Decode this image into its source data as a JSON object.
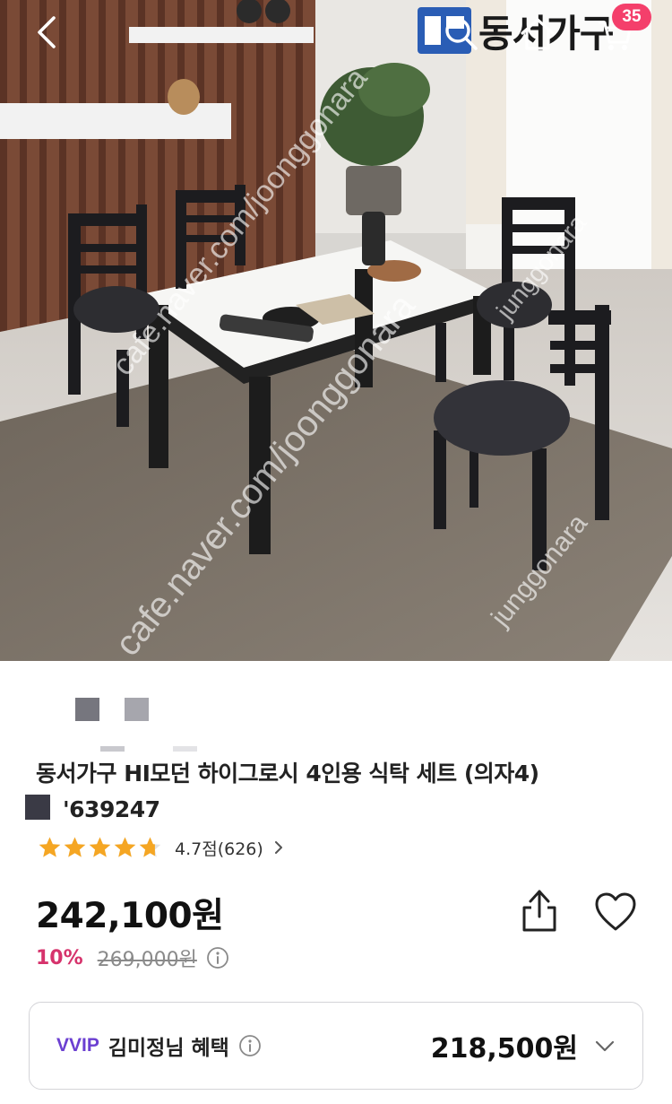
{
  "header": {
    "brand_name": "동서가구",
    "cart_count": "35",
    "icons": [
      "back-icon",
      "search-icon",
      "home-icon",
      "cart-icon"
    ]
  },
  "watermarks": {
    "cafe_url": "cafe.naver.com/joonggonara",
    "site_name": "junggonara"
  },
  "product": {
    "title": "동서가구 HI모던 하이그로시 4인용 식탁 세트 (의자4)",
    "code": "'639247",
    "rating_text": "4.7점(626)",
    "rating_value": 4.7,
    "rating_max": 5,
    "price": "242,100원",
    "discount_rate": "10%",
    "original_price": "269,000원"
  },
  "vvip": {
    "tag": "VVIP",
    "label": "김미정님 혜택",
    "price": "218,500원"
  },
  "colors": {
    "accent_pink": "#d6336c",
    "badge_pink": "#f43f6b",
    "vvip_purple": "#6b3fd1",
    "star_orange": "#f5a623"
  }
}
